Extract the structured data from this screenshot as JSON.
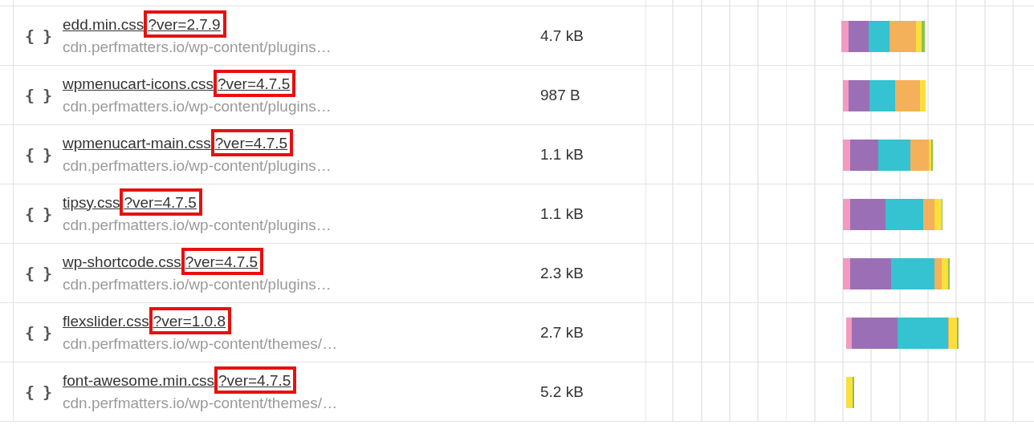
{
  "rows": [
    {
      "icon": "{ }",
      "file": "edd.min.css",
      "query": "?ver=2.7.9",
      "path": "cdn.perfmatters.io/wp-content/plugins…",
      "size": "4.7 kB"
    },
    {
      "icon": "{ }",
      "file": "wpmenucart-icons.css",
      "query": "?ver=4.7.5",
      "path": "cdn.perfmatters.io/wp-content/plugins…",
      "size": "987 B"
    },
    {
      "icon": "{ }",
      "file": "wpmenucart-main.css",
      "query": "?ver=4.7.5",
      "path": "cdn.perfmatters.io/wp-content/plugins…",
      "size": "1.1 kB"
    },
    {
      "icon": "{ }",
      "file": "tipsy.css",
      "query": "?ver=4.7.5",
      "path": "cdn.perfmatters.io/wp-content/plugins…",
      "size": "1.1 kB"
    },
    {
      "icon": "{ }",
      "file": "wp-shortcode.css",
      "query": "?ver=4.7.5",
      "path": "cdn.perfmatters.io/wp-content/plugins…",
      "size": "2.3 kB"
    },
    {
      "icon": "{ }",
      "file": "flexslider.css",
      "query": "?ver=1.0.8",
      "path": "cdn.perfmatters.io/wp-content/themes/…",
      "size": "2.7 kB"
    },
    {
      "icon": "{ }",
      "file": "font-awesome.min.css",
      "query": "?ver=4.7.5",
      "path": "cdn.perfmatters.io/wp-content/themes/…",
      "size": "5.2 kB"
    }
  ]
}
